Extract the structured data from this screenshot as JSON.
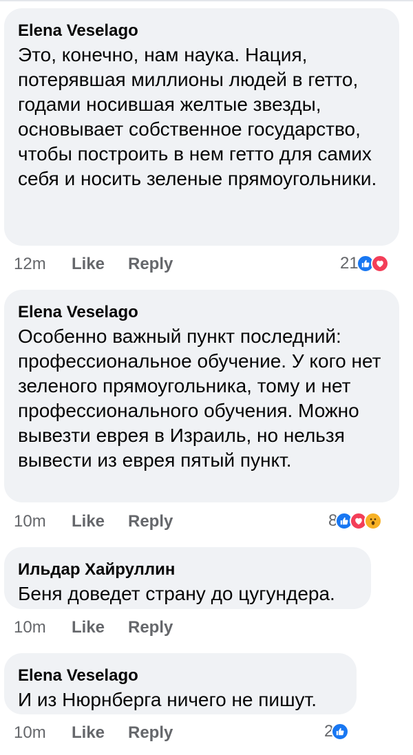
{
  "comments": [
    {
      "author": "Elena Veselago",
      "text": "Это, конечно, нам наука. Нация, потерявшая миллионы людей в гетто, годами носившая желтые звезды, основывает собственное государство, чтобы построить в нем гетто для самих себя и носить зеленые прямоугольники.",
      "time": "12m",
      "like_label": "Like",
      "reply_label": "Reply",
      "reaction_count": "21",
      "reactions": [
        "like",
        "love"
      ]
    },
    {
      "author": "Elena Veselago",
      "text": "Особенно важный пункт последний: профессиональное обучение. У кого нет зеленого прямоугольника, тому и нет профессионального обучения. Можно вывезти еврея в Израиль, но нельзя вывести из еврея пятый пункт.",
      "time": "10m",
      "like_label": "Like",
      "reply_label": "Reply",
      "reaction_count": "8",
      "reactions": [
        "like",
        "love",
        "wow"
      ]
    },
    {
      "author": "Ильдар Хайруллин",
      "text": "Беня доведет страну до цугундера.",
      "time": "10m",
      "like_label": "Like",
      "reply_label": "Reply"
    },
    {
      "author": "Elena Veselago",
      "text": "И из Нюрнберга ничего не пишут.",
      "time": "10m",
      "like_label": "Like",
      "reply_label": "Reply",
      "reaction_count": "2",
      "reactions": [
        "like"
      ]
    }
  ],
  "colors": {
    "bubble": "#f0f2f5",
    "meta_text": "#65676b",
    "like_reaction": "#1877f2",
    "love_reaction": "#f33e58",
    "wow_reaction": "#f7b125"
  }
}
